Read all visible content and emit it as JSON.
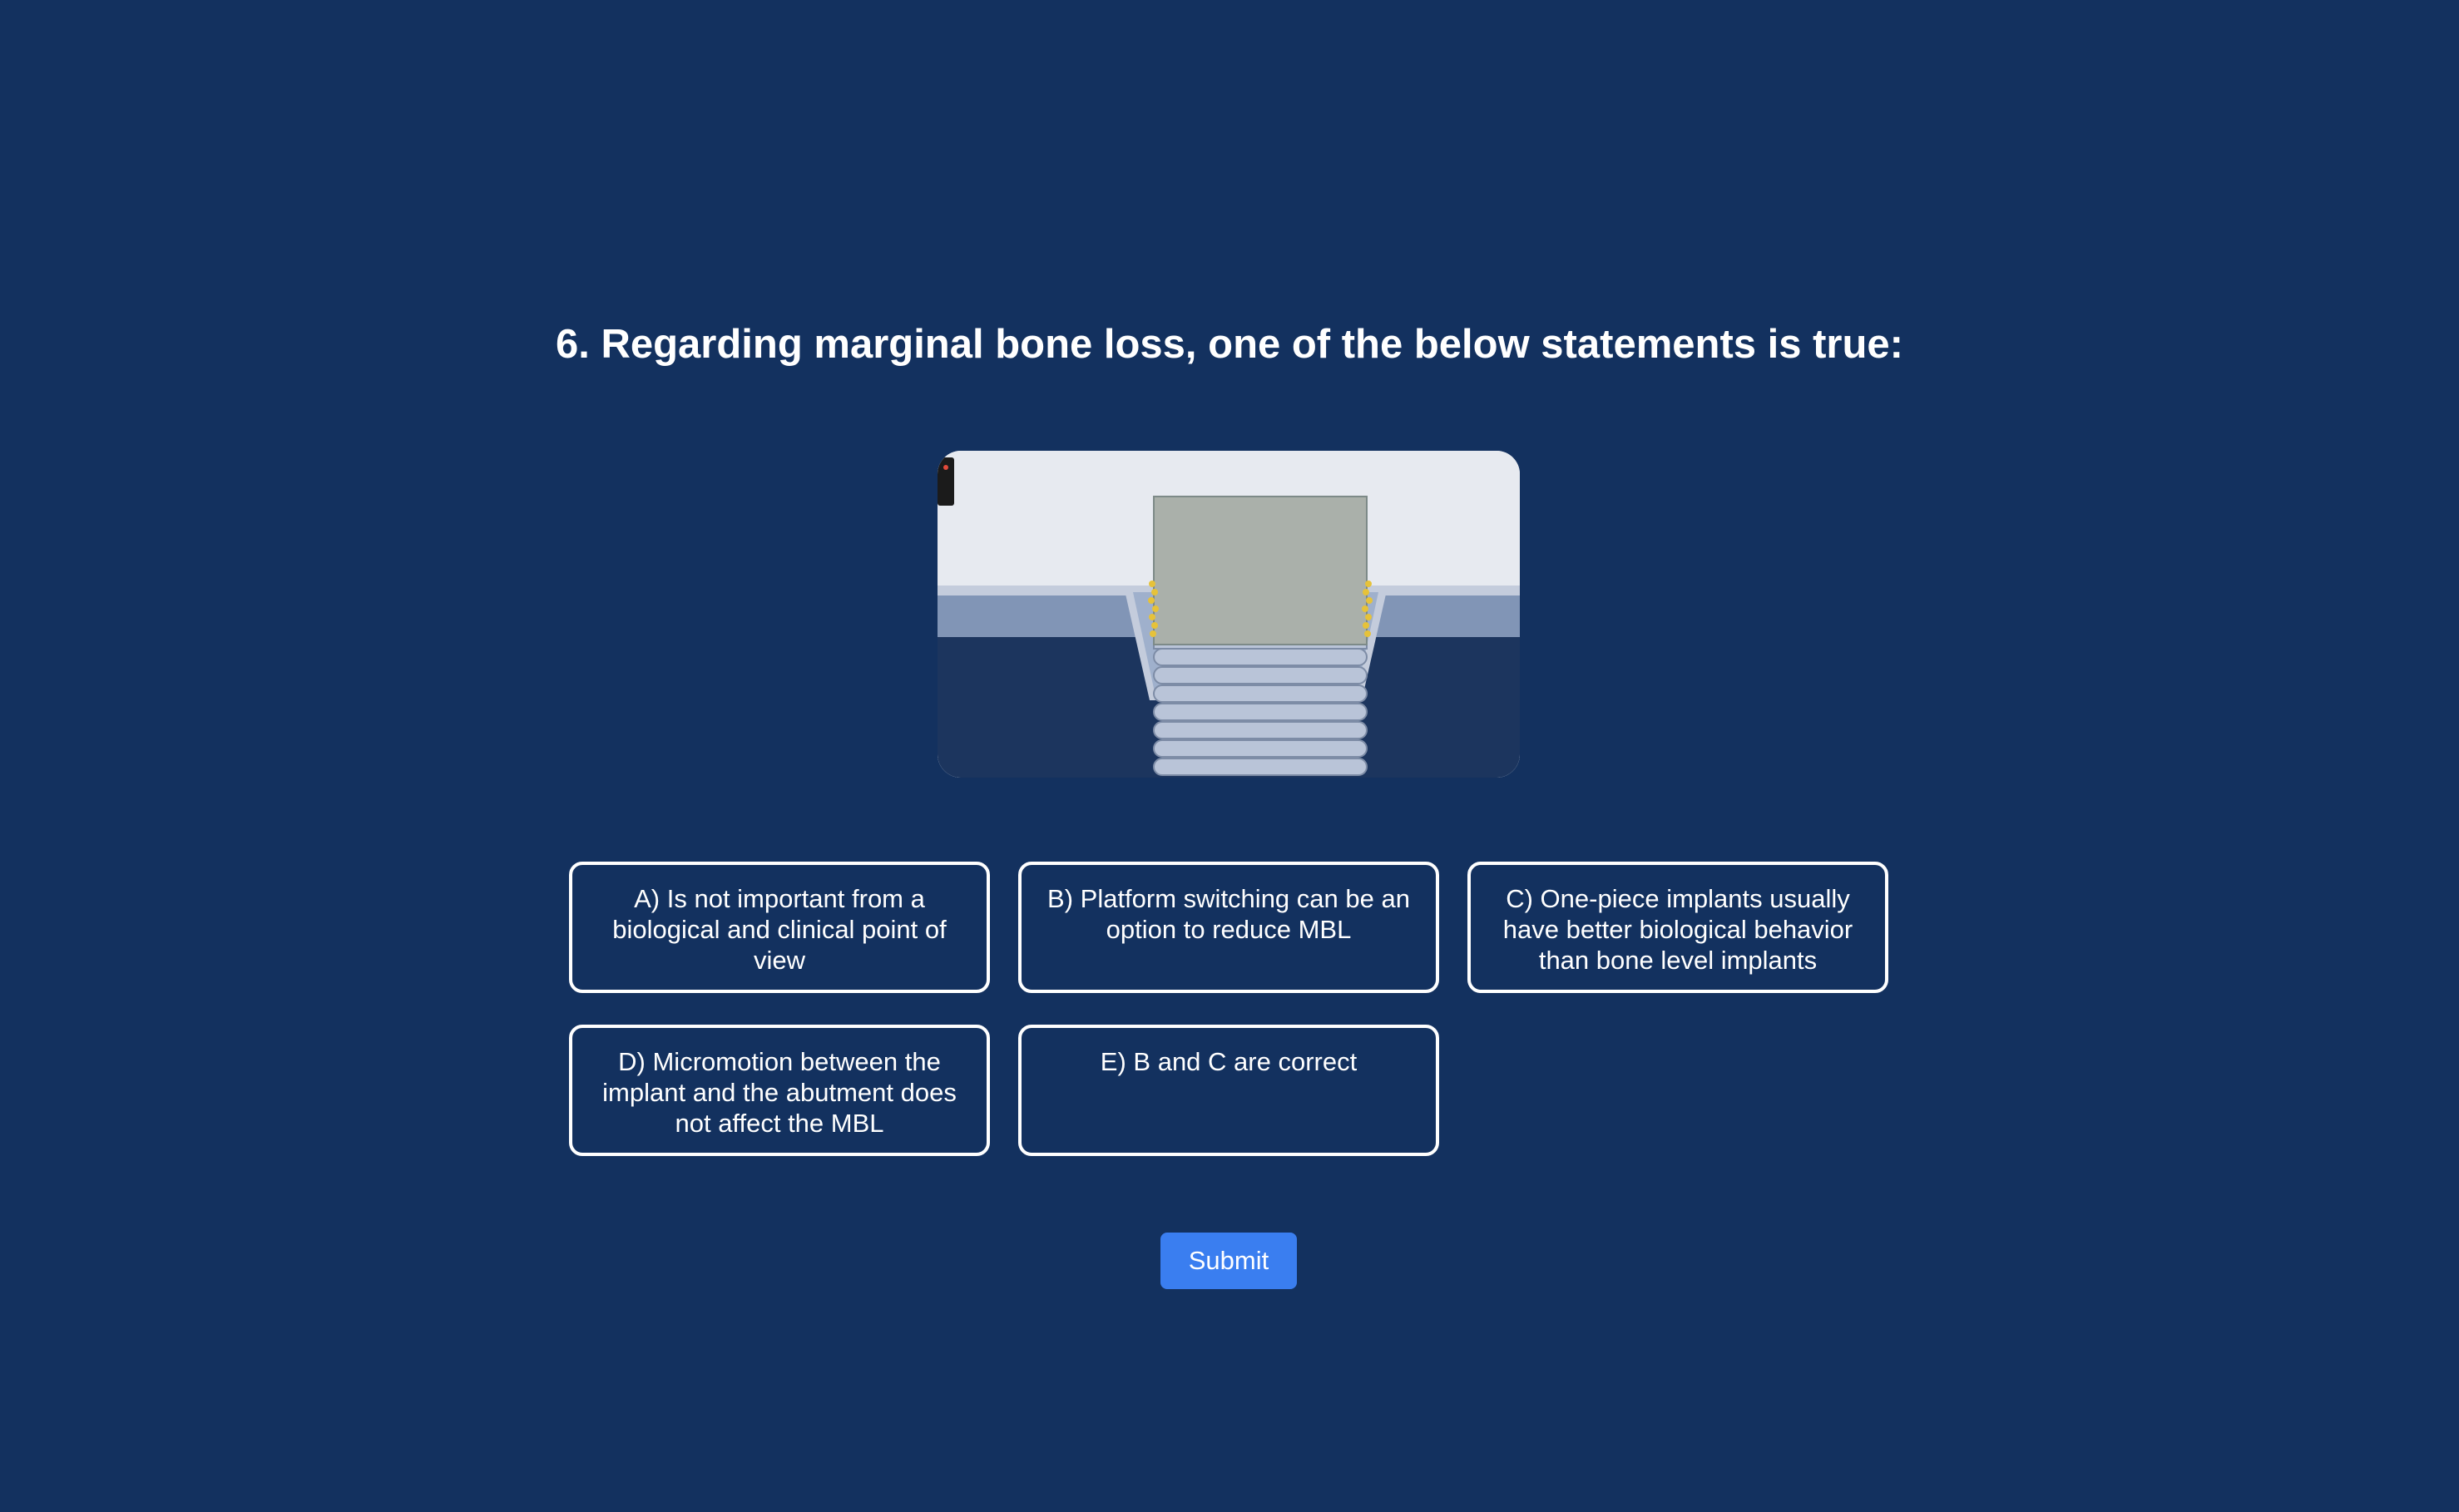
{
  "question": {
    "title": "6. Regarding marginal bone loss, one of the below statements is true:"
  },
  "illustration": {
    "icon": "dental-implant-cross-section"
  },
  "answers": [
    {
      "label": "A) Is not important from a biological and clinical point of view"
    },
    {
      "label": "B) Platform switching can be an option to reduce MBL"
    },
    {
      "label": "C) One-piece implants usually have better biological behavior than bone level implants"
    },
    {
      "label": "D) Micromotion between the implant and the abutment does not affect the MBL"
    },
    {
      "label": "E) B and C are correct"
    }
  ],
  "submit": {
    "label": "Submit"
  },
  "colors": {
    "background": "#13315f",
    "accent": "#3a7ef0",
    "border": "#ffffff"
  }
}
